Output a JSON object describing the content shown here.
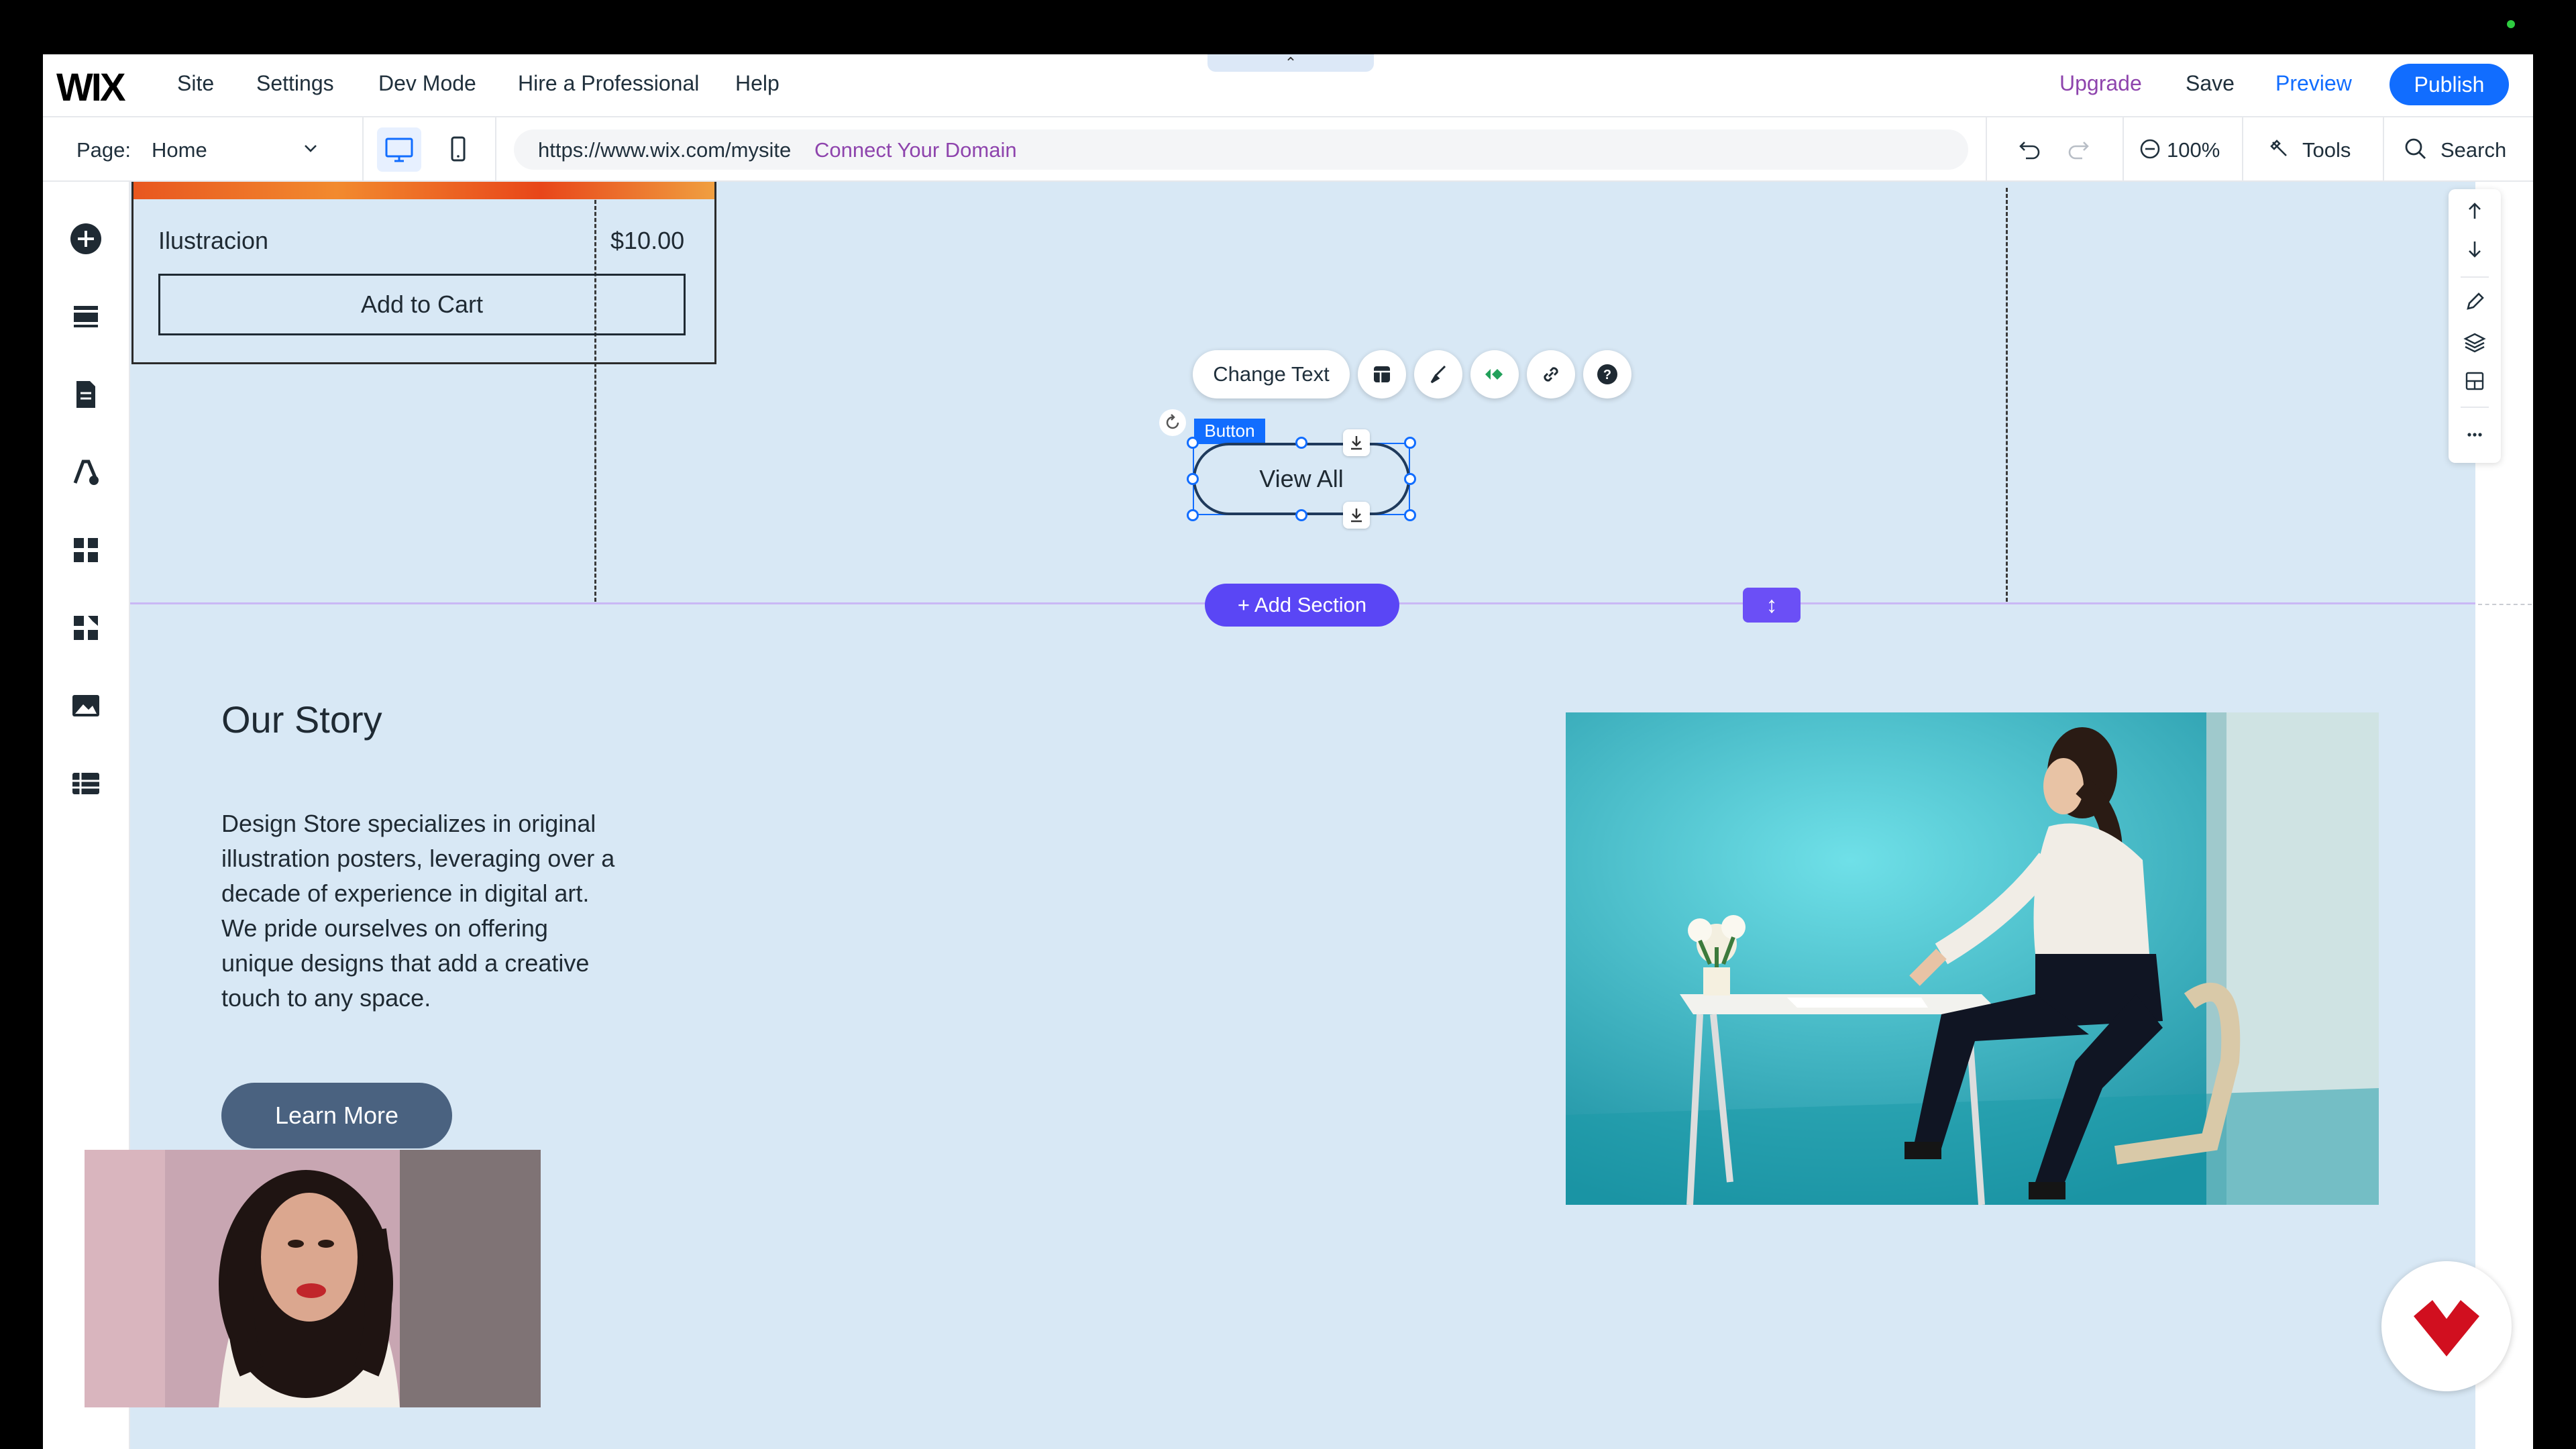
{
  "topbar": {
    "logo": "WIX",
    "menu": [
      "Site",
      "Settings",
      "Dev Mode",
      "Hire a Professional",
      "Help"
    ],
    "collapse_glyph": "⌃",
    "upgrade": "Upgrade",
    "save": "Save",
    "preview": "Preview",
    "publish": "Publish"
  },
  "secondbar": {
    "page_label": "Page:",
    "page_value": "Home",
    "url": "https://www.wix.com/mysite",
    "connect_domain": "Connect Your Domain",
    "zoom": "100%",
    "tools": "Tools",
    "search": "Search"
  },
  "leftrail": {
    "icons": [
      "add-icon",
      "sections-icon",
      "pages-icon",
      "design-icon",
      "apps-icon",
      "business-apps-icon",
      "media-icon",
      "cms-icon"
    ]
  },
  "product": {
    "name": "Ilustracion",
    "price": "$10.00",
    "add_to_cart": "Add to Cart"
  },
  "element_toolbar": {
    "change_text": "Change Text",
    "button_tag": "Button",
    "view_all": "View All"
  },
  "section": {
    "add_section": "Add Section",
    "add_glyph": "+",
    "stretch_glyph": "↕"
  },
  "story": {
    "title": "Our Story",
    "body": "Design Store specializes in original illustration posters, leveraging over a decade of experience in digital art. We pride ourselves on offering unique designs that add a creative touch to any space.",
    "cta": "Learn More"
  },
  "colors": {
    "accent": "#116dff",
    "upgrade": "#8e44ad",
    "add_section": "#5a46f5",
    "canvas_bg": "#d8e8f5",
    "learn_more": "#4a6280"
  }
}
